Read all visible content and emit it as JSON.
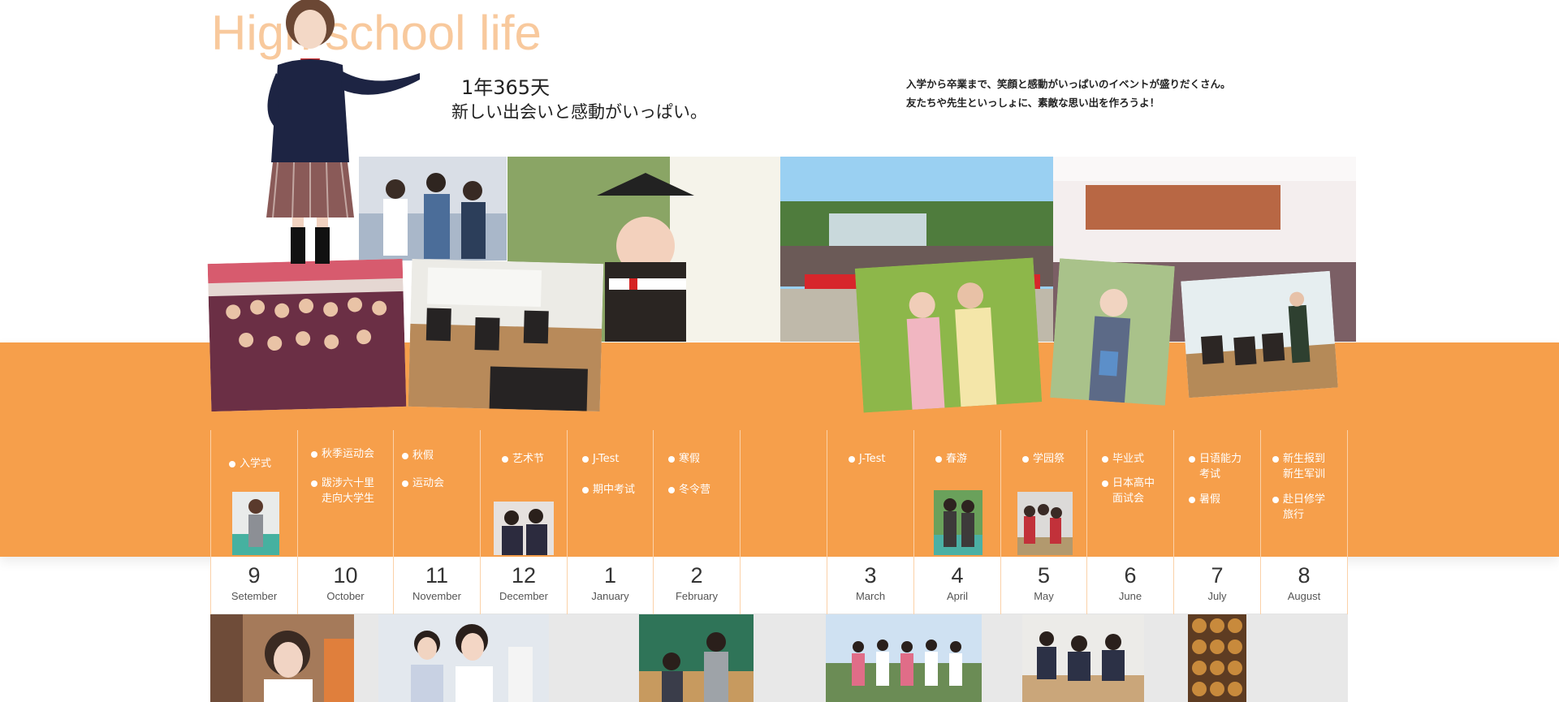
{
  "header": {
    "title": "High school life",
    "headline_1": "1年365天",
    "headline_2": "新しい出会いと感動がいっぱい。",
    "intro_line_1": "入学から卒業まで、笑顔と感動がいっぱいのイベントが盛りだくさん。",
    "intro_line_2": "友たちや先生といっしょに、素敵な思い出を作ろうよ！"
  },
  "colors": {
    "accent": "#f69f4b",
    "title": "#f8c99d",
    "grey": "#e8e8e8"
  },
  "timeline": [
    {
      "num": "9",
      "name": "Setember",
      "events": [
        "入学式"
      ]
    },
    {
      "num": "10",
      "name": "October",
      "events": [
        "秋季运动会",
        "跋涉六十里\n走向大学生"
      ]
    },
    {
      "num": "11",
      "name": "November",
      "events": [
        "秋假",
        "运动会"
      ]
    },
    {
      "num": "12",
      "name": "December",
      "events": [
        "艺术节"
      ]
    },
    {
      "num": "1",
      "name": "January",
      "events": [
        "J-Test",
        "期中考试"
      ]
    },
    {
      "num": "2",
      "name": "February",
      "events": [
        "寒假",
        "冬令营"
      ]
    },
    {
      "num": "",
      "name": "",
      "events": []
    },
    {
      "num": "3",
      "name": "March",
      "events": [
        "J-Test"
      ]
    },
    {
      "num": "4",
      "name": "April",
      "events": [
        "春游"
      ]
    },
    {
      "num": "5",
      "name": "May",
      "events": [
        "学园祭"
      ]
    },
    {
      "num": "6",
      "name": "June",
      "events": [
        "毕业式",
        "日本高中\n面试会"
      ]
    },
    {
      "num": "7",
      "name": "July",
      "events": [
        "日语能力\n考试",
        "暑假"
      ]
    },
    {
      "num": "8",
      "name": "August",
      "events": [
        "新生报到\n新生军训",
        "赴日修学\n旅行"
      ]
    }
  ]
}
